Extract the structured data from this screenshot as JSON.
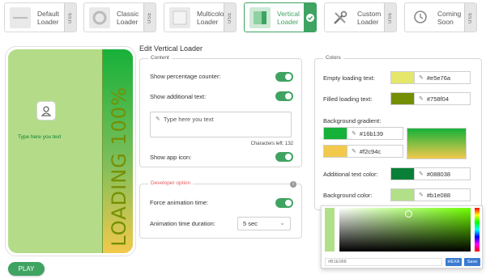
{
  "tabs": [
    {
      "label": "Default Loader",
      "use": "USE",
      "icon": "default-loader-thumb",
      "active": false
    },
    {
      "label": "Classic Loader",
      "use": "USE",
      "icon": "circle-loader-thumb",
      "active": false
    },
    {
      "label": "Multicolor Loader",
      "use": "USE",
      "icon": "multicolor-loader-thumb",
      "active": false
    },
    {
      "label": "Vertical Loader",
      "use": "",
      "icon": "vertical-loader-thumb",
      "active": true
    },
    {
      "label": "Custom Loader",
      "use": "USE",
      "icon": "tools-icon",
      "active": false
    },
    {
      "label": "Coming Soon",
      "use": "USE",
      "icon": "clock-icon",
      "active": false
    }
  ],
  "preview": {
    "additional_text": "Type here you text",
    "loading_text": "LOADING 100%"
  },
  "play_label": "PLAY",
  "edit_title": "Edit Vertical Loader",
  "content": {
    "legend": "Content",
    "show_percentage": "Show percentage counter:",
    "show_additional": "Show additional text:",
    "textarea_value": "Type here you text",
    "chars_left": "Characters left: 132",
    "show_app_icon": "Show app icon:"
  },
  "developer": {
    "legend": "Developer option",
    "force_animation": "Force animation time:",
    "animation_duration": "Animation time duration:",
    "duration_value": "5 sec"
  },
  "colors": {
    "legend": "Colors",
    "empty_label": "Empty loading text:",
    "empty_hex": "#e5e76a",
    "filled_label": "Filled loading text:",
    "filled_hex": "#758f04",
    "gradient_label": "Background gradient:",
    "grad1_hex": "#16b139",
    "grad2_hex": "#f2c94c",
    "additional_label": "Additional text color:",
    "additional_hex": "#088038",
    "background_label": "Background color:",
    "background_hex": "#b1e088"
  },
  "picker": {
    "hex_value": "#B1E088",
    "hexa_label": "HEXA",
    "save_label": "Save"
  },
  "palette": {
    "accent": "#3fa362",
    "empty": "#e5e76a",
    "filled": "#758f04",
    "grad1": "#16b139",
    "grad2": "#f2c94c",
    "additional": "#088038",
    "background": "#b1e088"
  }
}
